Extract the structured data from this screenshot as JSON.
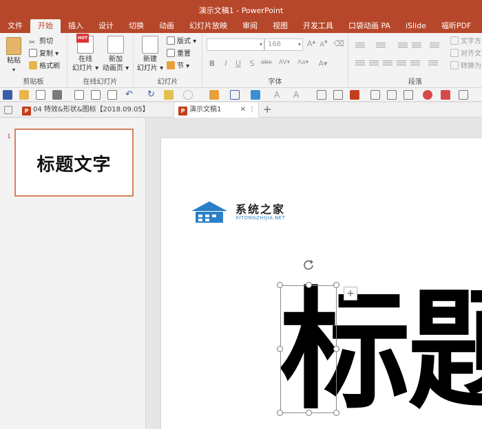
{
  "window": {
    "title": "演示文稿1 - PowerPoint"
  },
  "ribbon_tabs": [
    {
      "label": "文件"
    },
    {
      "label": "开始",
      "active": true
    },
    {
      "label": "插入"
    },
    {
      "label": "设计"
    },
    {
      "label": "切换"
    },
    {
      "label": "动画"
    },
    {
      "label": "幻灯片放映"
    },
    {
      "label": "审阅"
    },
    {
      "label": "视图"
    },
    {
      "label": "开发工具"
    },
    {
      "label": "口袋动画 PA"
    },
    {
      "label": "iSlide"
    },
    {
      "label": "福昕PDF"
    }
  ],
  "clipboard": {
    "group_label": "剪贴板",
    "paste_label": "粘贴",
    "cut_label": "剪切",
    "copy_label": "复制",
    "format_painter_label": "格式刷"
  },
  "online_slides": {
    "group_label": "在线幻灯片",
    "online_slide_label_1": "在线",
    "online_slide_label_2": "幻灯片",
    "new_anim_label_1": "新加",
    "new_anim_label_2": "动画页",
    "hot_badge": "HOT"
  },
  "slides_group": {
    "group_label": "幻灯片",
    "new_slide_label_1": "新建",
    "new_slide_label_2": "幻灯片",
    "layout_label": "版式",
    "reset_label": "重置",
    "section_label": "节"
  },
  "font_group": {
    "group_label": "字体",
    "font_size_value": "166",
    "bold": "B",
    "italic": "I",
    "underline": "U",
    "shadow": "S",
    "strike": "abc",
    "spacing": "AV",
    "case": "Aa",
    "color": "A",
    "grow": "A",
    "shrink": "A"
  },
  "paragraph_group": {
    "group_label": "段落",
    "text_direction_label": "文字方",
    "align_text_label": "对齐文",
    "convert_label": "转换为"
  },
  "document_tabs": [
    {
      "label": "04 特效&形状&图标【2018.09.05】",
      "icon": "P"
    },
    {
      "label": "演示文稿1",
      "icon": "P",
      "active": true
    }
  ],
  "thumbnail": {
    "number": "1",
    "title_text": "标题文字"
  },
  "slide": {
    "title_text": "标题"
  },
  "watermark": {
    "name_cn": "系统之家",
    "name_en": "XITONGZHIJIA.NET"
  },
  "colors": {
    "accent": "#b7472a",
    "thumbnail_border": "#d5805f"
  }
}
